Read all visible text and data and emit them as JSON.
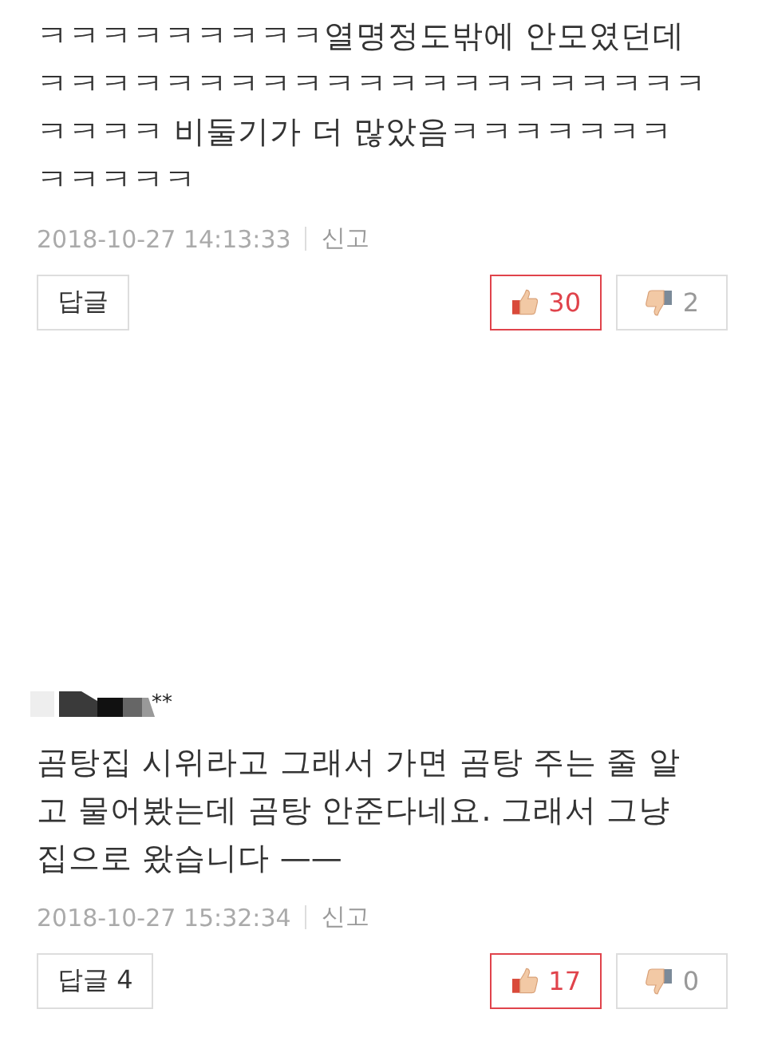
{
  "comments": [
    {
      "text_lines": [
        "ㅋㅋㅋㅋㅋㅋㅋㅋㅋ열명정도밖에 안모였던데",
        "ㅋㅋㅋㅋㅋㅋㅋㅋㅋㅋㅋㅋㅋㅋㅋㅋㅋㅋㅋㅋㅋ",
        "ㅋㅋㅋㅋ 비둘기가 더 많았음ㅋㅋㅋㅋㅋㅋㅋ",
        "ㅋㅋㅋㅋㅋ"
      ],
      "date": "2018-10-27 14:13:33",
      "report": "신고",
      "reply": "답글",
      "likes": {
        "count": "30",
        "selected": true
      },
      "dislikes": {
        "count": "2",
        "selected": false
      }
    },
    {
      "author": {
        "masked": true,
        "visible": "**"
      },
      "text_lines": [
        "곰탕집 시위라고 그래서 가면 곰탕 주는 줄 알",
        "고 물어봤는데 곰탕 안준다네요. 그래서 그냥",
        "집으로 왔습니다 ——"
      ],
      "date": "2018-10-27 15:32:34",
      "report": "신고",
      "reply": "답글 4",
      "likes": {
        "count": "17",
        "selected": true
      },
      "dislikes": {
        "count": "0",
        "selected": false
      }
    }
  ]
}
